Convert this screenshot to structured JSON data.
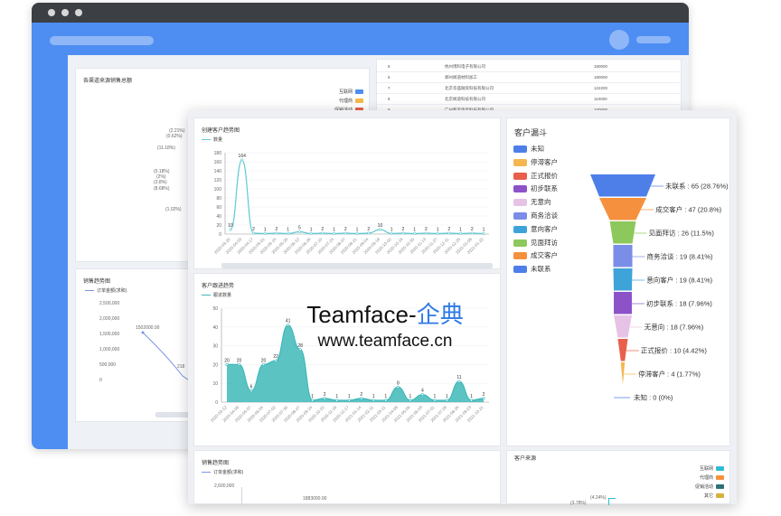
{
  "watermark": {
    "brand": "Teamface-",
    "brand_cn": "企典",
    "url": "www.teamface.cn"
  },
  "back": {
    "channel_panel": {
      "title": "各渠道来源销售总额",
      "legend": [
        {
          "label": "互联网",
          "color": "#4e8ef3"
        },
        {
          "label": "代理商",
          "color": "#f5b94a"
        },
        {
          "label": "促销活动",
          "color": "#e8604c"
        }
      ],
      "pct_labels": [
        "(2.21%)",
        "(0.62%)",
        "(11.18%)",
        "(0.18%)",
        "(2%)",
        "(3.8%)",
        "(8.68%)",
        "(1.02%)"
      ]
    },
    "table": {
      "rows": [
        {
          "no": "5",
          "name": "杭州博科电子有限公司",
          "amount": "180000"
        },
        {
          "no": "6",
          "name": "郑州闻道材料加工",
          "amount": "180000"
        },
        {
          "no": "7",
          "name": "北京华盛融资科技有限公司",
          "amount": "122200"
        },
        {
          "no": "8",
          "name": "北京闻道科技有限公司",
          "amount": "110000"
        },
        {
          "no": "9",
          "name": "广州和美珠宝科技有限公司",
          "amount": "100000"
        }
      ]
    },
    "sales_panel": {
      "title": "销售趋势图",
      "legend": "订单金额(求和)",
      "y_ticks": [
        "2,500,000",
        "2,000,000",
        "1,500,000",
        "1,000,000",
        "500,000",
        "0"
      ],
      "peak_label": "1502000.00",
      "end_label": "218"
    }
  },
  "front": {
    "create_chart": {
      "title": "创建客户趋势图",
      "legend": "数量",
      "color": "#5ec8d2",
      "y_ticks": [
        "180",
        "160",
        "140",
        "120",
        "100",
        "80",
        "60",
        "40",
        "20",
        "0"
      ],
      "chart_data": {
        "type": "line",
        "ylim": [
          0,
          180
        ],
        "x": [
          "2020-03-20",
          "2020-04-03",
          "2020-04-17",
          "2020-05-01",
          "2020-05-15",
          "2020-05-29",
          "2020-06-12",
          "2020-06-26",
          "2020-07-10",
          "2020-07-24",
          "2020-08-07",
          "2020-08-21",
          "2020-09-04",
          "2020-09-18",
          "2020-10-02",
          "2020-10-16",
          "2020-10-30",
          "2020-11-13",
          "2020-11-27",
          "2020-12-11",
          "2020-12-25",
          "2021-01-08",
          "2021-01-22"
        ],
        "values": [
          10,
          164,
          2,
          1,
          2,
          1,
          5,
          1,
          2,
          1,
          2,
          1,
          2,
          10,
          1,
          2,
          1,
          2,
          1,
          2,
          1,
          2,
          1
        ],
        "labels": [
          "10",
          "164",
          "2",
          "1",
          "2",
          "1",
          "5",
          "1",
          "2",
          "1",
          "2",
          "1",
          "2",
          "10",
          "1",
          "2",
          "1",
          "2",
          "1",
          "2",
          "1",
          "2",
          "1"
        ]
      }
    },
    "follow_chart": {
      "title": "客户跟进趋势",
      "legend": "跟进数量",
      "color": "#3fb8b8",
      "y_ticks": [
        "50",
        "40",
        "30",
        "20",
        "10",
        "0"
      ],
      "chart_data": {
        "type": "area",
        "ylim": [
          0,
          50
        ],
        "x": [
          "2020-03-12",
          "2020-04-09",
          "2020-05-07",
          "2020-06-04",
          "2020-07-02",
          "2020-07-30",
          "2020-08-27",
          "2020-09-24",
          "2020-10-22",
          "2020-11-19",
          "2020-12-17",
          "2021-01-14",
          "2021-02-11",
          "2021-03-11",
          "2021-04-08",
          "2021-05-06",
          "2021-06-03",
          "2021-07-01",
          "2021-07-29",
          "2021-08-26",
          "2021-09-23",
          "2021-10-21"
        ],
        "values": [
          20,
          20,
          6,
          20,
          22,
          41,
          28,
          1,
          2,
          1,
          1,
          2,
          1,
          1,
          8,
          1,
          4,
          1,
          1,
          11,
          1,
          2
        ],
        "labels": [
          "20",
          "20",
          "6",
          "20",
          "22",
          "41",
          "28",
          "1",
          "2",
          "1",
          "1",
          "2",
          "1",
          "1",
          "8",
          "1",
          "4",
          "1",
          "1",
          "11",
          "1",
          "2"
        ]
      }
    },
    "funnel": {
      "title": "客户漏斗",
      "legend": [
        {
          "label": "未知",
          "color": "#4e7fe8"
        },
        {
          "label": "停滞客户",
          "color": "#f4b64f"
        },
        {
          "label": "正式报价",
          "color": "#e8604c"
        },
        {
          "label": "初步联系",
          "color": "#8c52c8"
        },
        {
          "label": "无意向",
          "color": "#e6c3e6"
        },
        {
          "label": "商务洽谈",
          "color": "#7a8ee8"
        },
        {
          "label": "意向客户",
          "color": "#3ea3d9"
        },
        {
          "label": "见面拜访",
          "color": "#8cc85c"
        },
        {
          "label": "成交客户",
          "color": "#f5913e"
        },
        {
          "label": "未联系",
          "color": "#4e7fe8"
        }
      ],
      "chart_data": {
        "type": "funnel",
        "stages": [
          {
            "label": "未联系 : 65 (28.76%)",
            "value": 65,
            "color": "#4e7fe8"
          },
          {
            "label": "成交客户 : 47 (20.8%)",
            "value": 47,
            "color": "#f5913e"
          },
          {
            "label": "见面拜访 : 26 (11.5%)",
            "value": 26,
            "color": "#8cc85c"
          },
          {
            "label": "商务洽谈 : 19 (8.41%)",
            "value": 19,
            "color": "#7a8ee8"
          },
          {
            "label": "意向客户 : 19 (8.41%)",
            "value": 19,
            "color": "#3ea3d9"
          },
          {
            "label": "初步联系 : 18 (7.96%)",
            "value": 18,
            "color": "#8c52c8"
          },
          {
            "label": "无意向 : 18 (7.96%)",
            "value": 18,
            "color": "#e6c3e6"
          },
          {
            "label": "正式报价 : 10 (4.42%)",
            "value": 10,
            "color": "#e8604c"
          },
          {
            "label": "停滞客户 : 4 (1.77%)",
            "value": 4,
            "color": "#f4b64f"
          },
          {
            "label": "未知 : 0 (0%)",
            "value": 0,
            "color": "#4e7fe8"
          }
        ]
      }
    },
    "sales_small": {
      "title": "销售趋势图",
      "legend": "订单金额(求和)",
      "y_tick": "2,600,000",
      "value_label": "1883000.00"
    },
    "source_panel": {
      "title": "客户来源",
      "legend": [
        {
          "label": "互联网",
          "color": "#2fbcd2"
        },
        {
          "label": "代理商",
          "color": "#f5913e"
        },
        {
          "label": "促销活动",
          "color": "#2f6f7a"
        },
        {
          "label": "其它",
          "color": "#d8b03a"
        }
      ],
      "pct_labels": [
        "(4.24%)",
        "(3.78%)"
      ]
    }
  }
}
